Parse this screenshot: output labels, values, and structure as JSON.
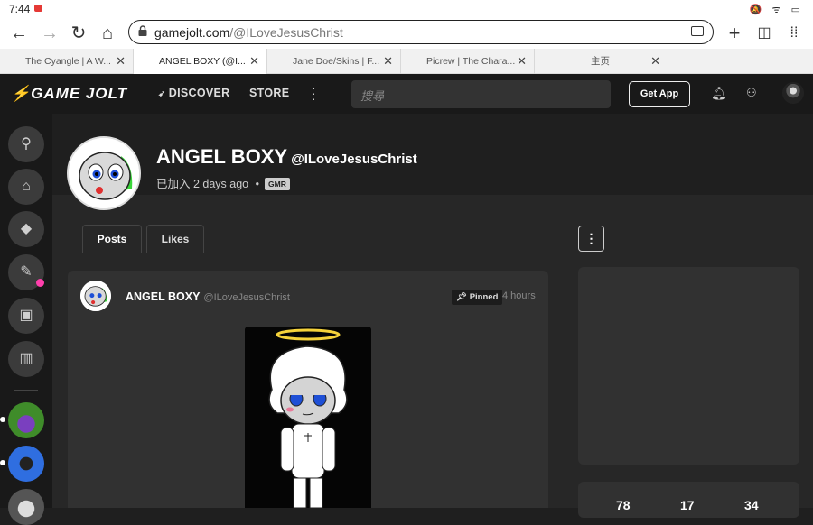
{
  "status": {
    "time": "7:44",
    "icons": "🔕 ᯤ ▭"
  },
  "browser": {
    "url_host": "gamejolt.com",
    "url_path": "/@ILoveJesusChrist",
    "tabs": [
      {
        "title": "The Cyangle | A W..."
      },
      {
        "title": "ANGEL BOXY (@I..."
      },
      {
        "title": "Jane Doe/Skins | F..."
      },
      {
        "title": "Picrew | The Chara..."
      },
      {
        "title": "主页"
      }
    ]
  },
  "nav": {
    "logo": "GAME JOLT",
    "discover": "DISCOVER",
    "store": "STORE",
    "search_placeholder": "搜尋",
    "get_app": "Get App"
  },
  "profile": {
    "display_name": "ANGEL BOXY",
    "handle": "@ILoveJesusChrist",
    "joined": "已加入 2 days ago",
    "badge": "GMR",
    "tabs": [
      "Posts",
      "Likes"
    ]
  },
  "post": {
    "author": "ANGEL BOXY",
    "handle": "@ILoveJesusChrist",
    "pinned": "Pinned",
    "time": "4 hours"
  },
  "stats": [
    "78",
    "17",
    "34"
  ],
  "colors": {
    "notification_dot": "#ff3fac",
    "halo": "#f5d23a",
    "eye_blue": "#1e4fd6",
    "accent_green": "#3ad63a"
  }
}
